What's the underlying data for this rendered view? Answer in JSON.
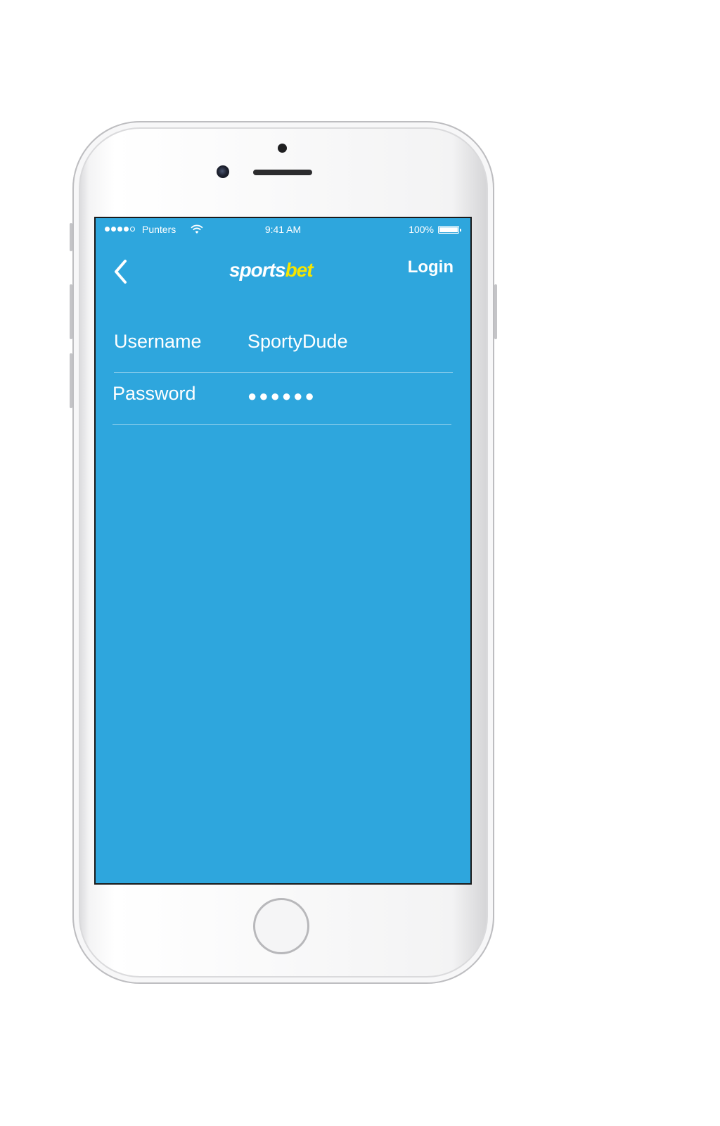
{
  "status_bar": {
    "carrier": "Punters",
    "time": "9:41 AM",
    "battery": "100%",
    "signal_strength": 4,
    "signal_max": 5
  },
  "nav": {
    "back_icon": "chevron-left-icon",
    "logo_part1": "sports",
    "logo_part2": "bet",
    "login_label": "Login"
  },
  "form": {
    "username_label": "Username",
    "username_value": "SportyDude",
    "password_label": "Password",
    "password_value": "●●●●●●"
  },
  "colors": {
    "screen_background": "#2ea6dd",
    "logo_accent": "#f5e500",
    "text": "#ffffff"
  }
}
